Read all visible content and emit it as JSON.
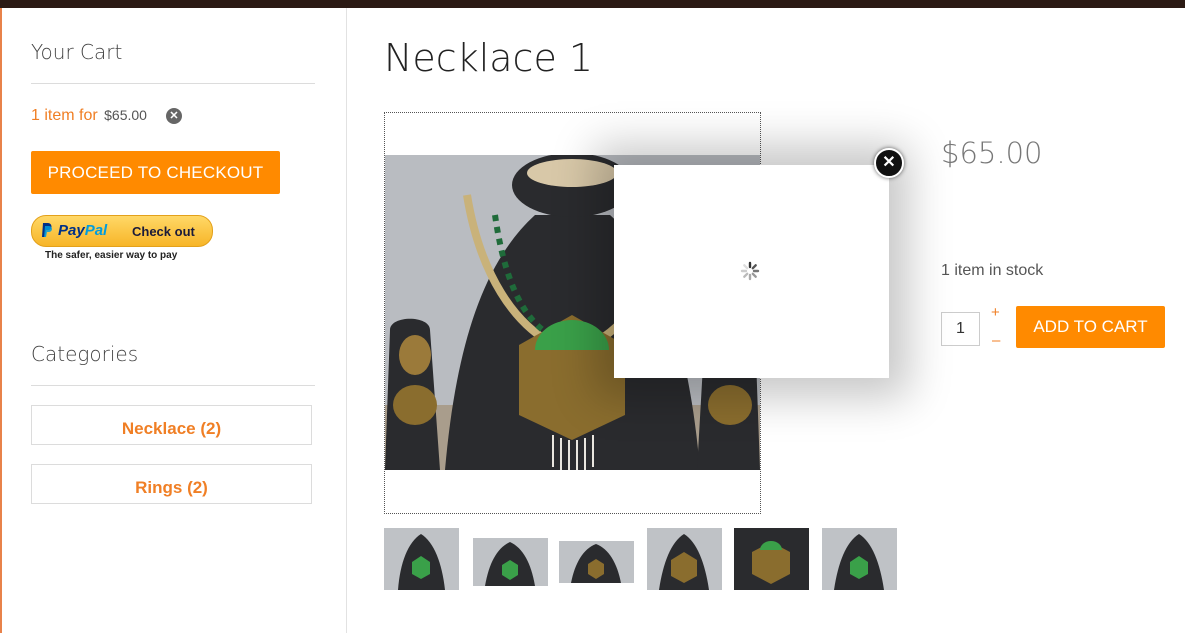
{
  "sidebar": {
    "cart_title": "Your Cart",
    "cart_summary_text": "1 item for",
    "cart_summary_amount": "$65.00",
    "remove_icon": "close-circle-icon",
    "checkout_label": "PROCEED TO CHECKOUT",
    "paypal": {
      "logo_p1": "Pay",
      "logo_p2": "Pal",
      "button_text": "Check out",
      "tagline": "The safer, easier way to pay"
    },
    "categories_title": "Categories",
    "categories": [
      {
        "label": "Necklace (2)"
      },
      {
        "label": "Rings (2)"
      }
    ]
  },
  "product": {
    "title": "Necklace 1",
    "price": "$65.00",
    "stock": "1 item in stock",
    "quantity": "1",
    "plus_symbol": "+",
    "minus_symbol": "–",
    "add_to_cart_label": "ADD TO CART",
    "thumbnail_count": 6
  },
  "lightbox": {
    "close_icon": "close-icon",
    "spinner_icon": "loading-spinner-icon"
  },
  "colors": {
    "accent": "#ff8a00",
    "link": "#f07f25",
    "topbar": "#2b1a14"
  }
}
